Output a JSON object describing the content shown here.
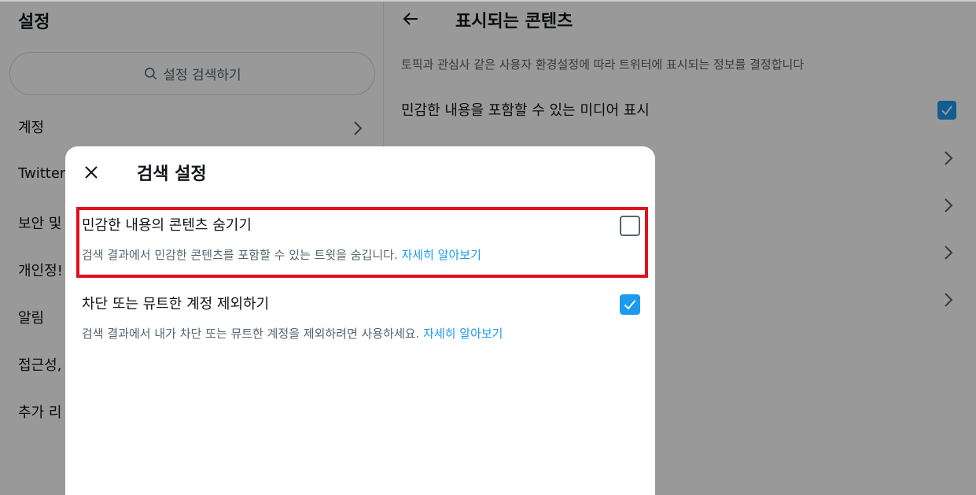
{
  "left": {
    "title": "설정",
    "search_placeholder": "설정 검색하기",
    "items": [
      {
        "label": "계정"
      },
      {
        "label": "Twitter"
      },
      {
        "label": "보안 및"
      },
      {
        "label": "개인정!"
      },
      {
        "label": "알림"
      },
      {
        "label": "접근성,"
      },
      {
        "label": "추가 리"
      }
    ]
  },
  "right": {
    "title": "표시되는 콘텐츠",
    "description": "토픽과 관심사 같은 사용자 환경설정에 따라 트위터에 표시되는 정보를 결정합니다",
    "sensitive_media_label": "민감한 내용을 포함할 수 있는 미디어 표시",
    "sensitive_media_checked": true
  },
  "modal": {
    "title": "검색 설정",
    "options": [
      {
        "label": "민감한 내용의 콘텐츠 숨기기",
        "description": "검색 결과에서 민감한 콘텐츠를 포함할 수 있는 트윗을 숨깁니다.",
        "link": "자세히 알아보기",
        "checked": false
      },
      {
        "label": "차단 또는 뮤트한 계정 제외하기",
        "description": "검색 결과에서 내가 차단 또는 뮤트한 계정을 제외하려면 사용하세요.",
        "link": "자세히 알아보기",
        "checked": true
      }
    ]
  },
  "colors": {
    "accent": "#1d9bf0",
    "highlight": "#e0101e"
  }
}
